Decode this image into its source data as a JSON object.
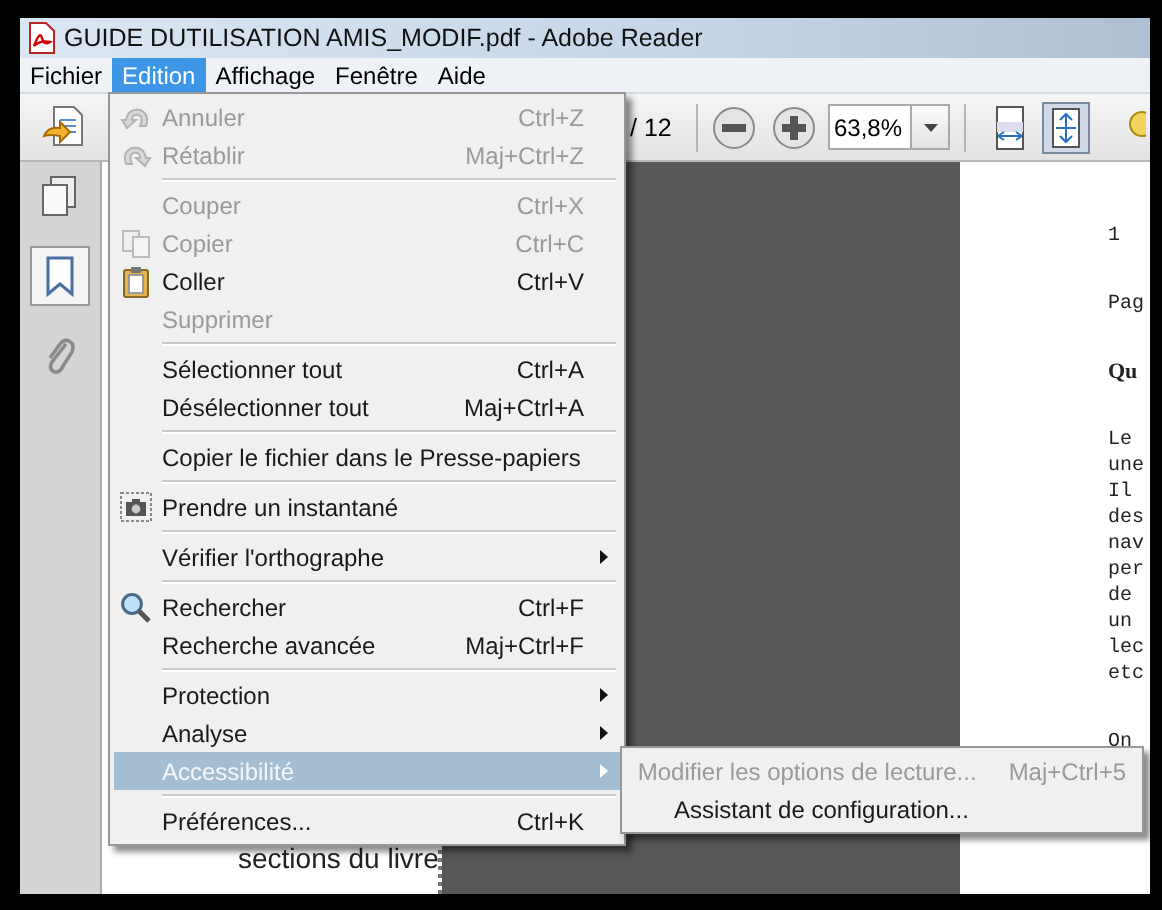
{
  "window": {
    "title": "GUIDE DUTILISATION AMIS_MODIF.pdf - Adobe Reader"
  },
  "menu_bar": [
    {
      "label": "Fichier",
      "selected": false
    },
    {
      "label": "Edition",
      "selected": true
    },
    {
      "label": "Affichage",
      "selected": false
    },
    {
      "label": "Fenêtre",
      "selected": false
    },
    {
      "label": "Aide",
      "selected": false
    }
  ],
  "toolbar": {
    "page_total": "/ 12",
    "zoom": "63,8%"
  },
  "sidebar": {
    "text": "sections du livre"
  },
  "document": {
    "paragraphs": [
      {
        "bold": false,
        "lines": [
          "1"
        ]
      },
      {
        "bold": false,
        "lines": [
          "Pag"
        ]
      },
      {
        "bold": true,
        "lines": [
          "Qu"
        ]
      },
      {
        "bold": false,
        "lines": [
          "Le",
          "une",
          "Il",
          "des",
          "nav",
          "per",
          "de",
          "un",
          "lec",
          "etc"
        ]
      },
      {
        "bold": false,
        "lines": [
          "On"
        ]
      }
    ]
  },
  "edit_menu": {
    "items": [
      {
        "kind": "item",
        "label": "Annuler",
        "shortcut": "Ctrl+Z",
        "disabled": true,
        "selected": false,
        "has_submenu": false
      },
      {
        "kind": "item",
        "label": "Rétablir",
        "shortcut": "Maj+Ctrl+Z",
        "disabled": true,
        "selected": false,
        "has_submenu": false
      },
      {
        "kind": "separator"
      },
      {
        "kind": "item",
        "label": "Couper",
        "shortcut": "Ctrl+X",
        "disabled": true,
        "selected": false,
        "has_submenu": false
      },
      {
        "kind": "item",
        "label": "Copier",
        "shortcut": "Ctrl+C",
        "disabled": true,
        "selected": false,
        "has_submenu": false
      },
      {
        "kind": "item",
        "label": "Coller",
        "shortcut": "Ctrl+V",
        "disabled": false,
        "selected": false,
        "has_submenu": false
      },
      {
        "kind": "item",
        "label": "Supprimer",
        "disabled": true,
        "selected": false,
        "has_submenu": false
      },
      {
        "kind": "separator"
      },
      {
        "kind": "item",
        "label": "Sélectionner tout",
        "shortcut": "Ctrl+A",
        "disabled": false,
        "selected": false,
        "has_submenu": false
      },
      {
        "kind": "item",
        "label": "Désélectionner tout",
        "shortcut": "Maj+Ctrl+A",
        "disabled": false,
        "selected": false,
        "has_submenu": false
      },
      {
        "kind": "separator"
      },
      {
        "kind": "item",
        "label": "Copier le fichier dans le Presse-papiers",
        "disabled": false,
        "selected": false,
        "has_submenu": false
      },
      {
        "kind": "separator"
      },
      {
        "kind": "item",
        "label": "Prendre un instantané",
        "disabled": false,
        "selected": false,
        "has_submenu": false
      },
      {
        "kind": "separator"
      },
      {
        "kind": "item",
        "label": "Vérifier l'orthographe",
        "disabled": false,
        "selected": false,
        "has_submenu": true
      },
      {
        "kind": "separator"
      },
      {
        "kind": "item",
        "label": "Rechercher",
        "shortcut": "Ctrl+F",
        "disabled": false,
        "selected": false,
        "has_submenu": false
      },
      {
        "kind": "item",
        "label": "Recherche avancée",
        "shortcut": "Maj+Ctrl+F",
        "disabled": false,
        "selected": false,
        "has_submenu": false
      },
      {
        "kind": "separator"
      },
      {
        "kind": "item",
        "label": "Protection",
        "disabled": false,
        "selected": false,
        "has_submenu": true
      },
      {
        "kind": "item",
        "label": "Analyse",
        "disabled": false,
        "selected": false,
        "has_submenu": true
      },
      {
        "kind": "item",
        "label": "Accessibilité",
        "disabled": false,
        "selected": true,
        "has_submenu": true
      },
      {
        "kind": "separator"
      },
      {
        "kind": "item",
        "label": "Préférences...",
        "shortcut": "Ctrl+K",
        "disabled": false,
        "selected": false,
        "has_submenu": false
      }
    ]
  },
  "submenu": {
    "items": [
      {
        "kind": "item",
        "label": "Modifier les options de lecture...",
        "shortcut": "Maj+Ctrl+5",
        "disabled": true,
        "selected": false
      },
      {
        "kind": "item",
        "label": "Assistant de configuration...",
        "disabled": false,
        "selected": false
      }
    ]
  }
}
